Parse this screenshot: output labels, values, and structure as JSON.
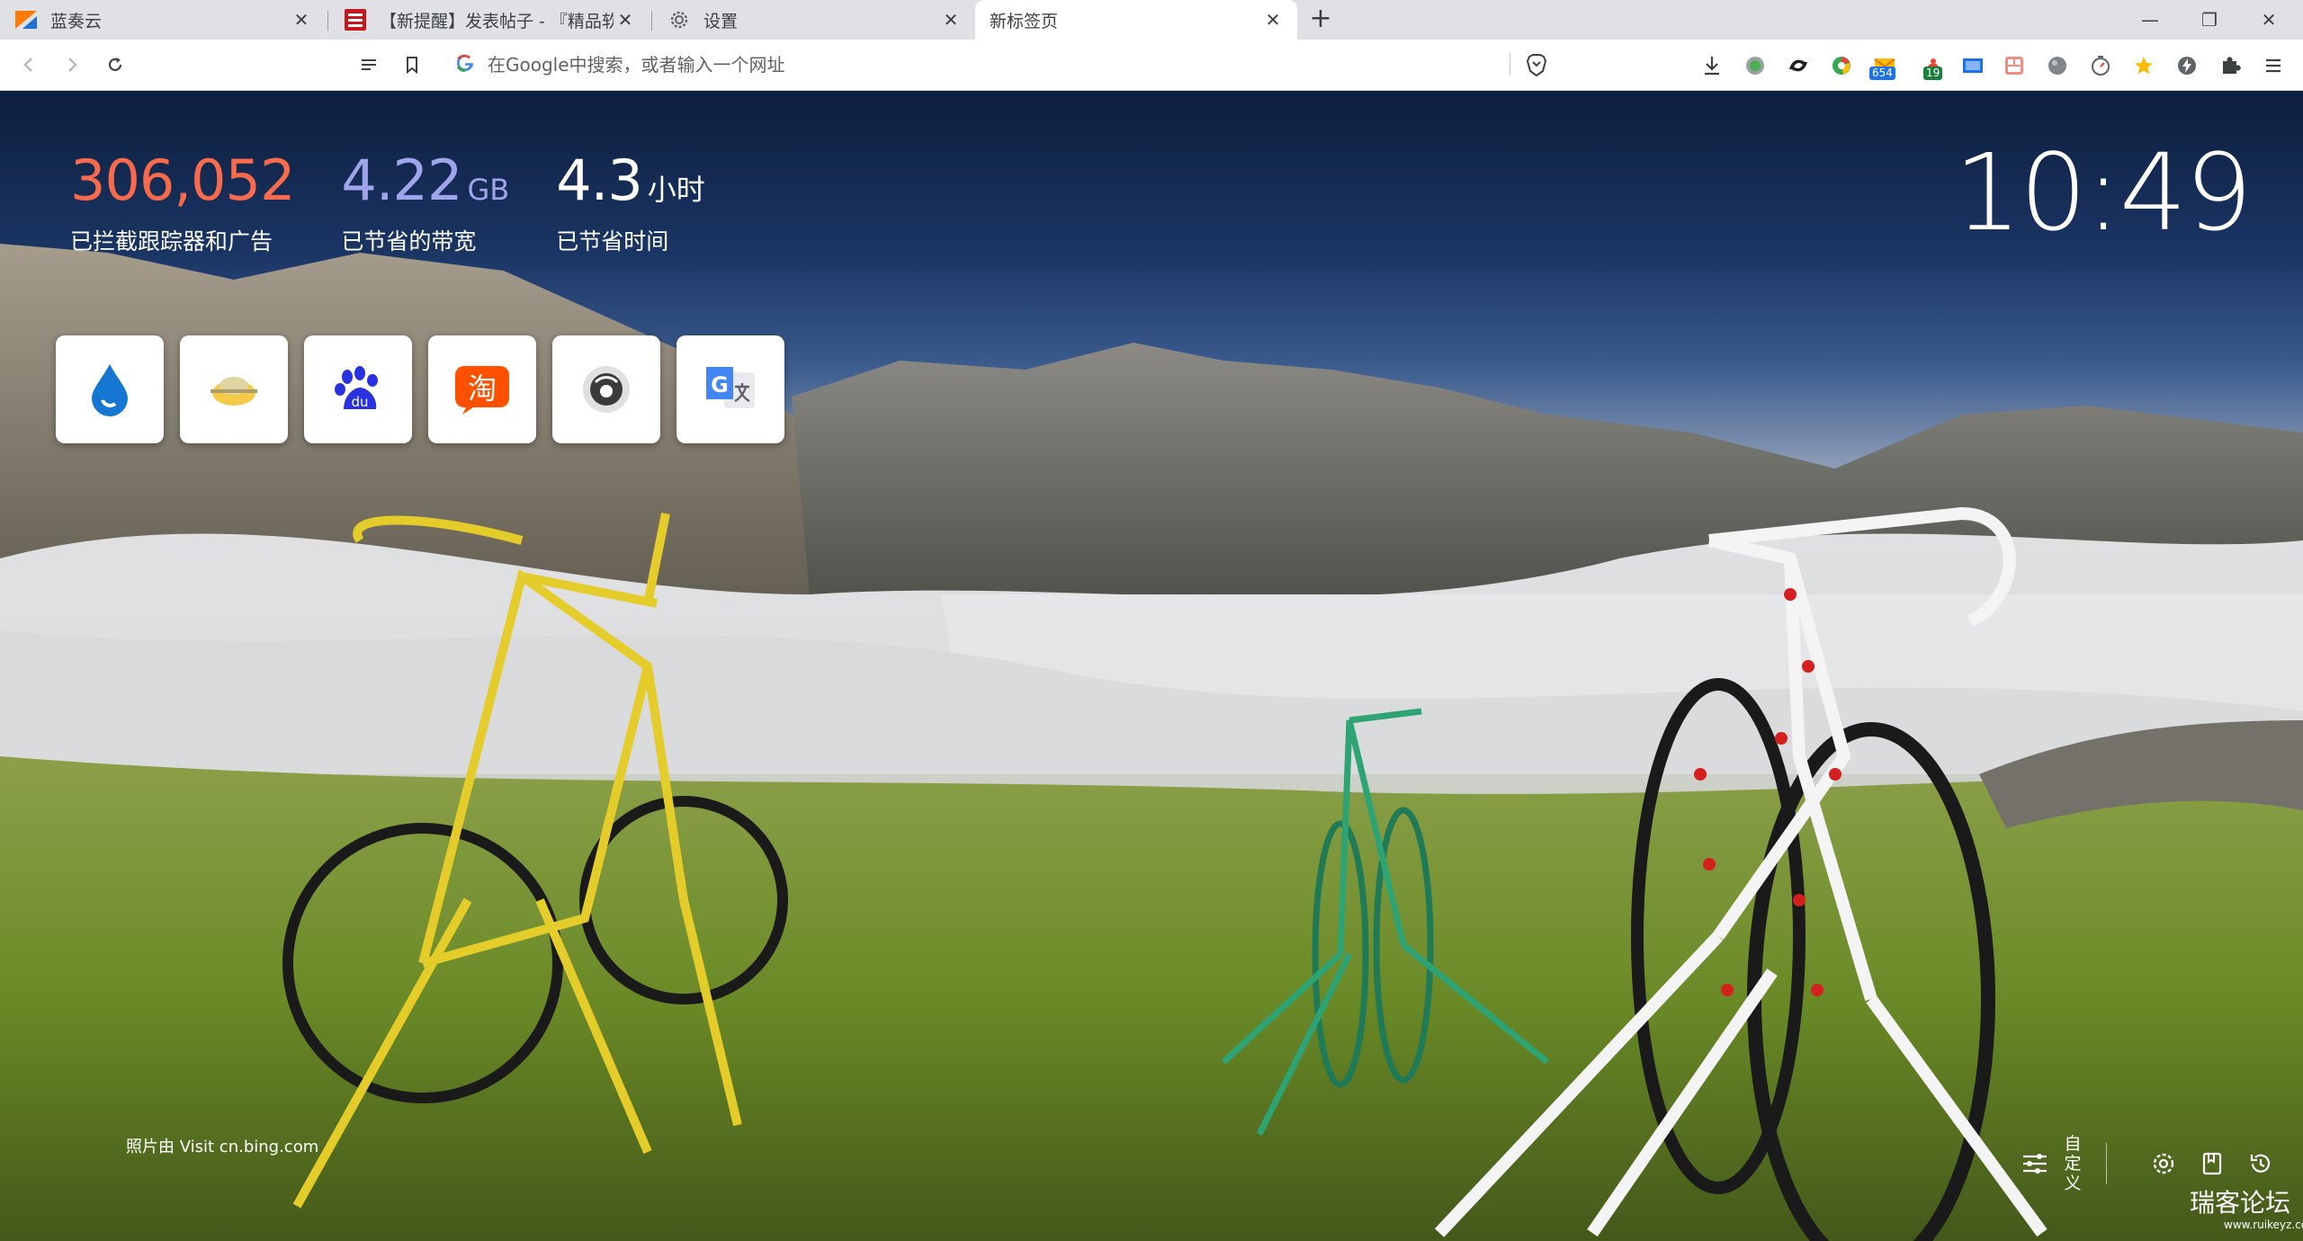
{
  "tabs": [
    {
      "title": "蓝奏云",
      "favicon": "lanzou-icon"
    },
    {
      "title": "【新提醒】发表帖子 - 『精品软件",
      "favicon": "forum-icon"
    },
    {
      "title": "设置",
      "favicon": "gear-icon"
    },
    {
      "title": "新标签页",
      "favicon": "none",
      "active": true
    }
  ],
  "window": {
    "newtab_label": "+",
    "minimize_label": "—",
    "restore_label": "❐",
    "close_label": "✕"
  },
  "toolbar": {
    "omnibox_placeholder": "在Google中搜索，或者输入一个网址",
    "ext_badges": {
      "mail": "654",
      "notify": "19"
    }
  },
  "ntp": {
    "stats": [
      {
        "value": "306,052",
        "unit": "",
        "label": "已拦截跟踪器和广告",
        "color": "#f76b4c"
      },
      {
        "value": "4.22",
        "unit": "GB",
        "label": "已节省的带宽",
        "color": "#a0a5eb"
      },
      {
        "value": "4.3",
        "unit": "小时",
        "label": "已节省时间",
        "color": "#ffffff"
      }
    ],
    "clock": "10:49",
    "top_sites": [
      {
        "name": "site-tile-water"
      },
      {
        "name": "site-tile-bird"
      },
      {
        "name": "site-tile-baidu",
        "text": "du"
      },
      {
        "name": "site-tile-taobao",
        "text": "淘"
      },
      {
        "name": "site-tile-camera"
      },
      {
        "name": "site-tile-google-translate",
        "text": "G"
      }
    ],
    "photo_credit": "照片由 Visit cn.bing.com",
    "customize_label": "自定义",
    "watermark": "瑞客论坛",
    "watermark_sub": "www.ruikeyz.com"
  },
  "colors": {
    "brave_orange": "#fb542b",
    "tab_bg": "#dfe1e5"
  }
}
